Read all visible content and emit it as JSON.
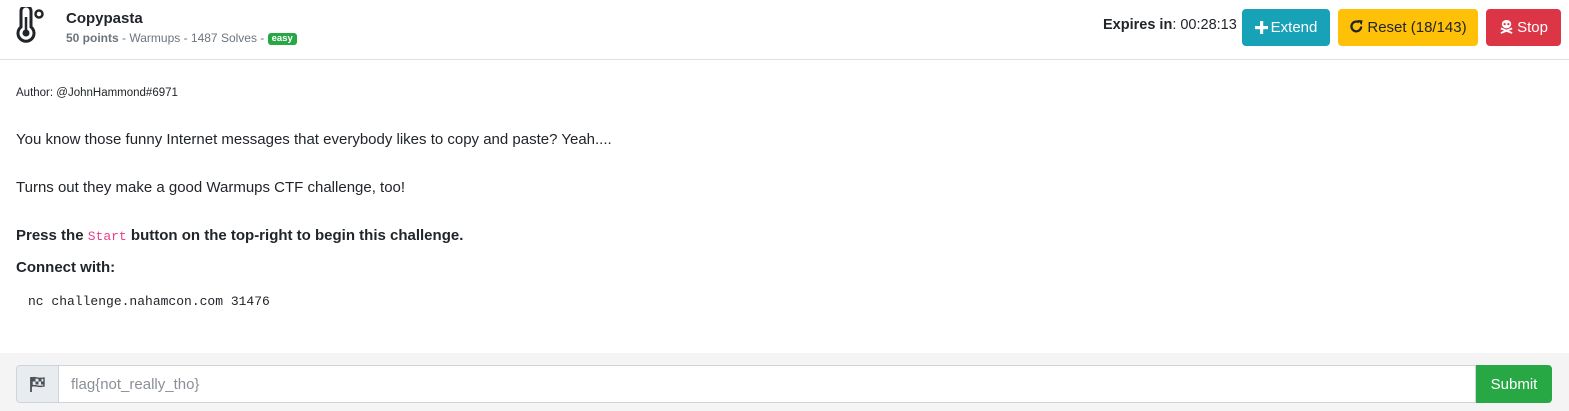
{
  "challenge": {
    "category_icon": "thermometer-icon",
    "title": "Copypasta",
    "points": "50 points",
    "meta_rest": " - Warmups - 1487 Solves - ",
    "difficulty": "easy"
  },
  "timer": {
    "label": "Expires in",
    "value": ": 00:28:13"
  },
  "buttons": {
    "extend": {
      "label": "Extend",
      "icon": "plus-icon",
      "color": "#17a2b8"
    },
    "reset": {
      "label": "Reset (18/143)",
      "icon": "redo-icon",
      "color": "#ffc107"
    },
    "stop": {
      "label": "Stop",
      "icon": "skull-crossbones-icon",
      "color": "#dc3545"
    }
  },
  "description": {
    "author": "Author: @JohnHammond#6971",
    "paragraph1": "You know those funny Internet messages that everybody likes to copy and paste? Yeah....",
    "paragraph2": "Turns out they make a good Warmups CTF challenge, too!",
    "press_prefix": "Press the ",
    "press_code": "Start",
    "press_suffix": " button on the top-right to begin this challenge.",
    "connect_label": "Connect with:",
    "command": "nc challenge.nahamcon.com 31476"
  },
  "flag_form": {
    "icon": "flag-checkered-icon",
    "placeholder": "flag{not_really_tho}",
    "submit_label": "Submit",
    "submit_color": "#28a745"
  }
}
